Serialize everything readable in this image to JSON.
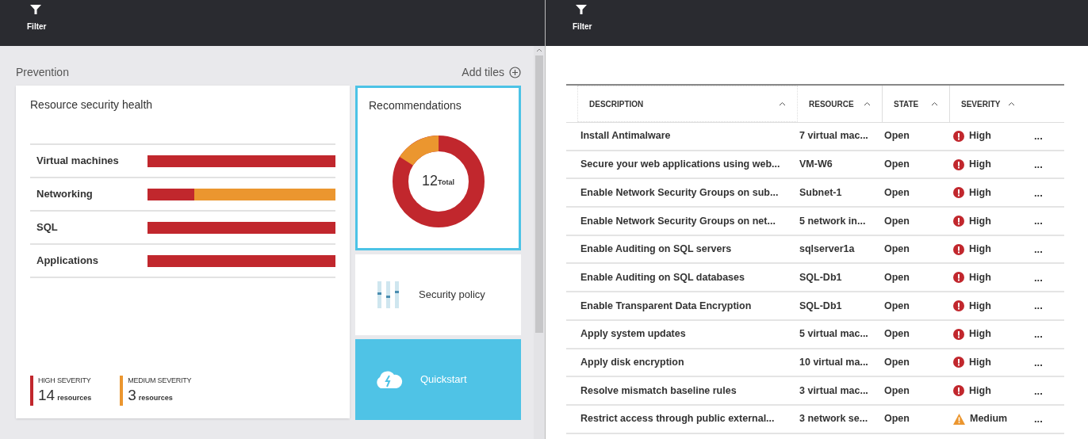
{
  "left_panel": {
    "toolbar": {
      "filter_label": "Filter"
    },
    "section_title": "Prevention",
    "add_tiles": "Add tiles",
    "health_tile": {
      "title": "Resource security health",
      "rows": [
        {
          "label": "Virtual machines",
          "kind": "high"
        },
        {
          "label": "Networking",
          "kind": "mixed"
        },
        {
          "label": "SQL",
          "kind": "high"
        },
        {
          "label": "Applications",
          "kind": "high"
        }
      ],
      "legend": [
        {
          "title": "HIGH SEVERITY",
          "count": "14",
          "unit": "resources",
          "color": "#c1272d"
        },
        {
          "title": "MEDIUM SEVERITY",
          "count": "3",
          "unit": "resources",
          "color": "#eb962f"
        }
      ]
    },
    "recommendations_tile": {
      "title": "Recommendations",
      "total": "12",
      "total_label": "Total",
      "selected": true
    },
    "policy_tile": {
      "title": "Security policy"
    },
    "quickstart_tile": {
      "title": "Quickstart"
    }
  },
  "right_panel": {
    "toolbar": {
      "filter_label": "Filter"
    },
    "table": {
      "columns": [
        "DESCRIPTION",
        "RESOURCE",
        "STATE",
        "SEVERITY"
      ],
      "rows": [
        {
          "description": "Install Antimalware",
          "resource": "7 virtual mac...",
          "state": "Open",
          "severity": "High",
          "kind": "high"
        },
        {
          "description": "Secure your web applications using web...",
          "resource": "VM-W6",
          "state": "Open",
          "severity": "High",
          "kind": "high"
        },
        {
          "description": "Enable Network Security Groups on sub...",
          "resource": "Subnet-1",
          "state": "Open",
          "severity": "High",
          "kind": "high"
        },
        {
          "description": "Enable Network Security Groups on net...",
          "resource": "5 network in...",
          "state": "Open",
          "severity": "High",
          "kind": "high"
        },
        {
          "description": "Enable Auditing on SQL servers",
          "resource": "sqlserver1a",
          "state": "Open",
          "severity": "High",
          "kind": "high"
        },
        {
          "description": "Enable Auditing on SQL databases",
          "resource": "SQL-Db1",
          "state": "Open",
          "severity": "High",
          "kind": "high"
        },
        {
          "description": "Enable Transparent Data Encryption",
          "resource": "SQL-Db1",
          "state": "Open",
          "severity": "High",
          "kind": "high"
        },
        {
          "description": "Apply system updates",
          "resource": "5 virtual mac...",
          "state": "Open",
          "severity": "High",
          "kind": "high"
        },
        {
          "description": "Apply disk encryption",
          "resource": "10 virtual ma...",
          "state": "Open",
          "severity": "High",
          "kind": "high"
        },
        {
          "description": "Resolve mismatch baseline rules",
          "resource": "3 virtual mac...",
          "state": "Open",
          "severity": "High",
          "kind": "high"
        },
        {
          "description": "Restrict access through public external...",
          "resource": "3 network se...",
          "state": "Open",
          "severity": "Medium",
          "kind": "medium"
        }
      ],
      "more_label": "..."
    }
  }
}
